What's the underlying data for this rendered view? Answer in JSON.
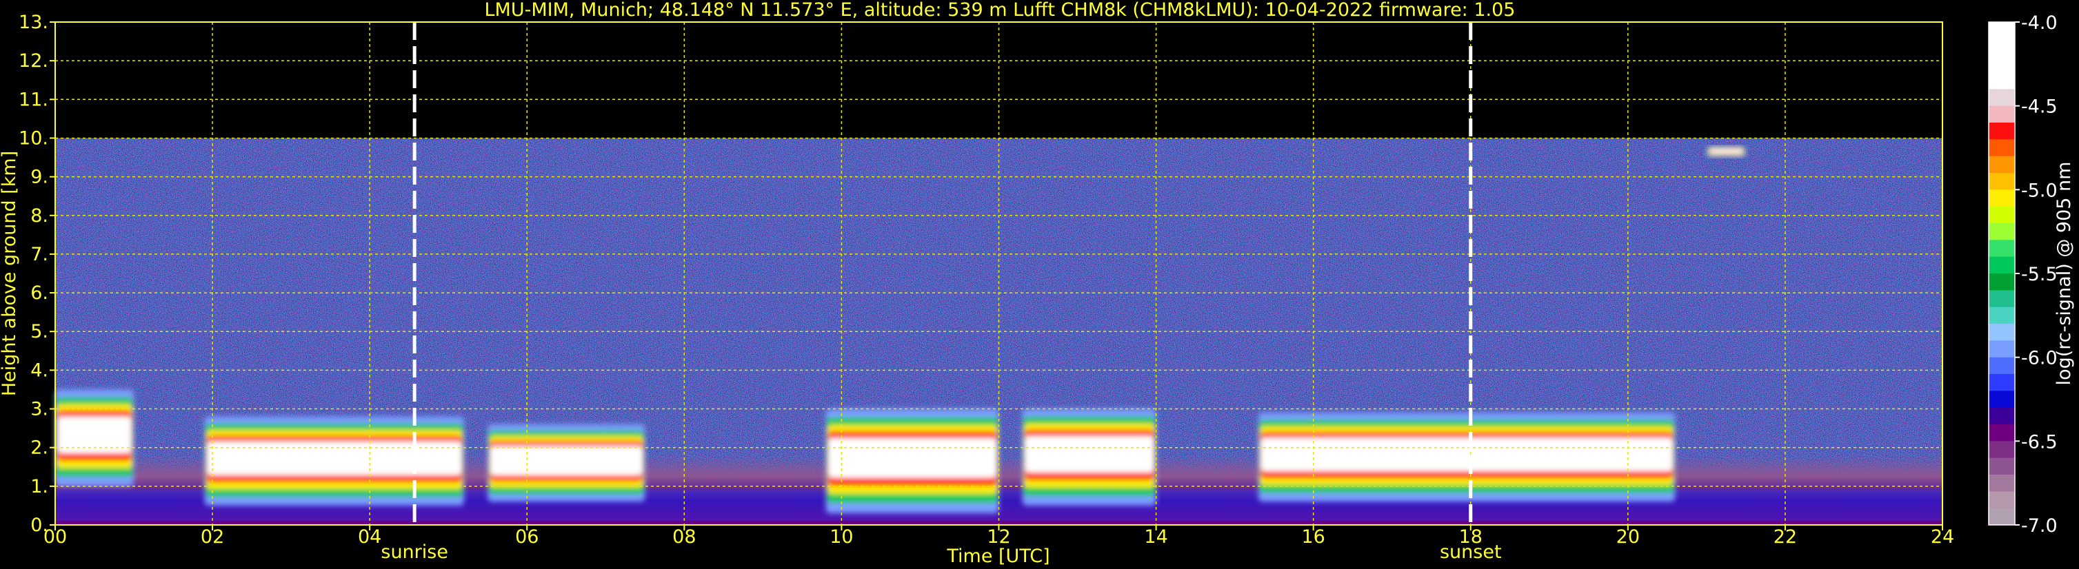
{
  "chart_data": {
    "type": "heatmap",
    "title": "LMU-MIM, Munich; 48.148° N 11.573° E, altitude: 539 m    Lufft CHM8k (CHM8kLMU): 10-04-2022    firmware: 1.05",
    "xlabel": "Time [UTC]",
    "ylabel": "Height above ground [km]",
    "xlim": [
      0,
      24
    ],
    "ylim": [
      0,
      13
    ],
    "x_ticks": [
      "00",
      "02",
      "04",
      "06",
      "08",
      "10",
      "12",
      "14",
      "16",
      "18",
      "20",
      "22",
      "24"
    ],
    "y_ticks": [
      "0.",
      "1.",
      "2.",
      "3.",
      "4.",
      "5.",
      "6.",
      "7.",
      "8.",
      "9.",
      "10.",
      "11.",
      "12.",
      "13."
    ],
    "grid": true,
    "grid_color": "#e8e800",
    "signal_top_km": 10,
    "events": [
      {
        "label": "sunrise",
        "time_hours": 4.57
      },
      {
        "label": "sunset",
        "time_hours": 18.0
      }
    ],
    "colorbar": {
      "label": "log(rc-signal) @ 905 nm",
      "range": [
        -7.0,
        -4.0
      ],
      "ticks": [
        "-4.0",
        "-4.5",
        "-5.0",
        "-5.5",
        "-6.0",
        "-6.5",
        "-7.0"
      ],
      "colors": [
        "#ffffff",
        "#ffffff",
        "#ffffff",
        "#ffffff",
        "#e6d6da",
        "#f2b6bf",
        "#ff1010",
        "#ff5a00",
        "#ff9600",
        "#ffc000",
        "#ffee00",
        "#d2ff00",
        "#9bff33",
        "#33e06a",
        "#00c85a",
        "#00a032",
        "#1fc08e",
        "#49d3c0",
        "#94c4ff",
        "#7a9eff",
        "#4f6eff",
        "#2d3cff",
        "#0a0ad8",
        "#3a0099",
        "#6e0080",
        "#7d2f86",
        "#8e5592",
        "#a2789d",
        "#b598ac",
        "#b0a0b0"
      ]
    },
    "cloud_features": [
      {
        "desc": "boundary-layer aerosol top km",
        "start_hour": 0.0,
        "end_hour": 24.0,
        "top_km": 1.8
      },
      {
        "desc": "cloud layer",
        "start_hour": 0.0,
        "end_hour": 1.0,
        "base_km": 1.0,
        "top_km": 3.5
      },
      {
        "desc": "cloud layer",
        "start_hour": 1.9,
        "end_hour": 5.2,
        "base_km": 0.5,
        "top_km": 2.8
      },
      {
        "desc": "cloud layer",
        "start_hour": 5.5,
        "end_hour": 7.5,
        "base_km": 0.6,
        "top_km": 2.6
      },
      {
        "desc": "cloud layer",
        "start_hour": 9.8,
        "end_hour": 12.0,
        "base_km": 0.3,
        "top_km": 3.0
      },
      {
        "desc": "cloud layer",
        "start_hour": 12.3,
        "end_hour": 14.0,
        "base_km": 0.5,
        "top_km": 3.0
      },
      {
        "desc": "cloud layer",
        "start_hour": 15.3,
        "end_hour": 20.6,
        "base_km": 0.6,
        "top_km": 2.9
      },
      {
        "desc": "elevated cloud",
        "start_hour": 21.0,
        "end_hour": 21.5,
        "base_km": 9.5,
        "top_km": 9.8
      }
    ]
  }
}
